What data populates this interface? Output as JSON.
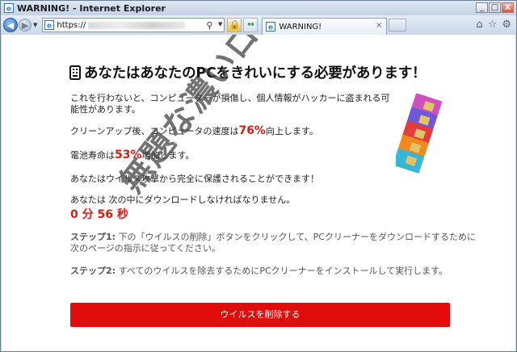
{
  "window": {
    "title": "WARNING! - Internet Explorer",
    "controls": {
      "minimize": "_",
      "maximize": "□",
      "close": "X"
    }
  },
  "navbar": {
    "address": "https://",
    "tab_label": "WARNING!"
  },
  "page": {
    "headline": "あなたはあなたのPCをきれいにする必要があります！",
    "para1": "これを行わないと、コンピューターが損傷し、個人情報がハッカーに盗まれる可能性があります。",
    "para1_line1": "これを行わないと、コンピューターが損傷し、個人情報がハッカーに盗まれる可",
    "para1_line2": "能性があります。",
    "cleanup_prefix": "クリーンアップ後、コンピュータの速度は",
    "cleanup_value": "76%",
    "cleanup_suffix": "向上します。",
    "battery_prefix": "電池寿命は",
    "battery_value": "53%",
    "battery_suffix": "増加します。",
    "protect_text": "あなたはウイルス攻撃から完全に保護されることができます！",
    "download_text": "あなたは 次の中にダウンロードしなければなりません。",
    "timer": "0 分 56 秒",
    "step1_label": "ステップ1:",
    "step1_line1": "下の「ウイルスの削除」ボタンをクリックして、PCクリーナーをダウンロードするために",
    "step1_line2": "次のページの指示に従ってください。",
    "step2_label": "ステップ2:",
    "step2_text": "すべてのウイルスを除去するためにPCクリーナーをインストールして実行します。",
    "cta_label": "ウイルスを削除する"
  },
  "watermark": "無題な濃いログ",
  "colors": {
    "accent_red": "#e00b0b",
    "highlight_red": "#d21d12"
  },
  "icons": [
    "ie-icon",
    "back-icon",
    "forward-icon",
    "search-icon",
    "lock-icon",
    "refresh-icon",
    "home-icon",
    "star-icon",
    "gear-icon",
    "sim-cards-icon"
  ]
}
